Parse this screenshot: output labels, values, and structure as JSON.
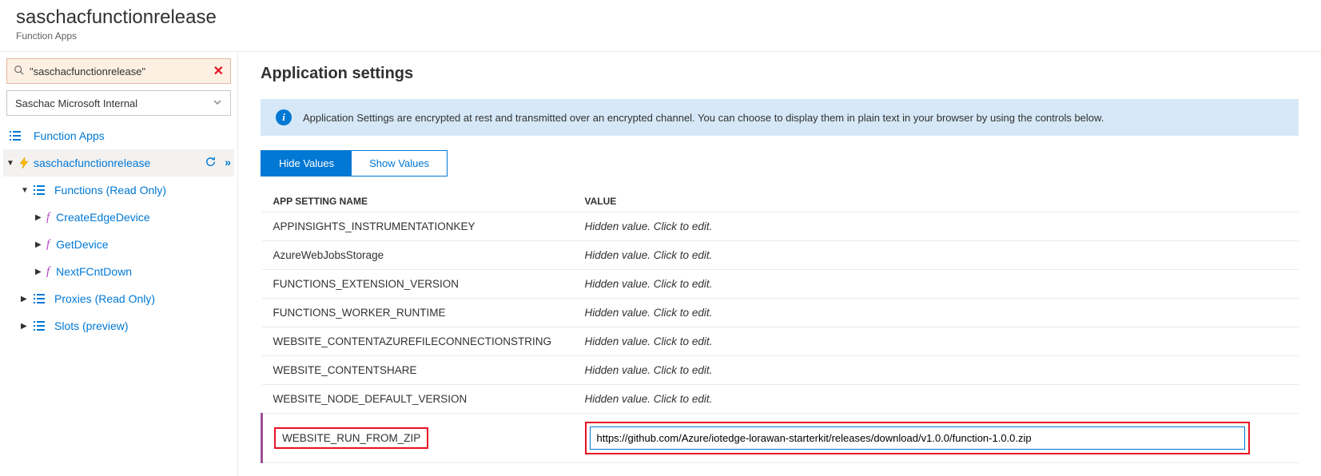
{
  "header": {
    "title": "saschacfunctionrelease",
    "subtitle": "Function Apps"
  },
  "sidebar": {
    "search": {
      "value": "\"saschacfunctionrelease\"",
      "clear_icon": "✕"
    },
    "subscription": "Saschac Microsoft Internal",
    "top_link": "Function Apps",
    "app_name": "saschacfunctionrelease",
    "nodes": {
      "functions": "Functions (Read Only)",
      "proxies": "Proxies (Read Only)",
      "slots": "Slots (preview)"
    },
    "func_items": [
      {
        "label": "CreateEdgeDevice"
      },
      {
        "label": "GetDevice"
      },
      {
        "label": "NextFCntDown"
      }
    ]
  },
  "main": {
    "title": "Application settings",
    "info": "Application Settings are encrypted at rest and transmitted over an encrypted channel. You can choose to display them in plain text in your browser by using the controls below.",
    "buttons": {
      "hide": "Hide Values",
      "show": "Show Values"
    },
    "columns": {
      "name": "APP SETTING NAME",
      "value": "VALUE"
    },
    "hidden_text": "Hidden value. Click to edit.",
    "settings": [
      {
        "name": "APPINSIGHTS_INSTRUMENTATIONKEY"
      },
      {
        "name": "AzureWebJobsStorage"
      },
      {
        "name": "FUNCTIONS_EXTENSION_VERSION"
      },
      {
        "name": "FUNCTIONS_WORKER_RUNTIME"
      },
      {
        "name": "WEBSITE_CONTENTAZUREFILECONNECTIONSTRING"
      },
      {
        "name": "WEBSITE_CONTENTSHARE"
      },
      {
        "name": "WEBSITE_NODE_DEFAULT_VERSION"
      }
    ],
    "highlight": {
      "name": "WEBSITE_RUN_FROM_ZIP",
      "value": "https://github.com/Azure/iotedge-lorawan-starterkit/releases/download/v1.0.0/function-1.0.0.zip"
    }
  }
}
